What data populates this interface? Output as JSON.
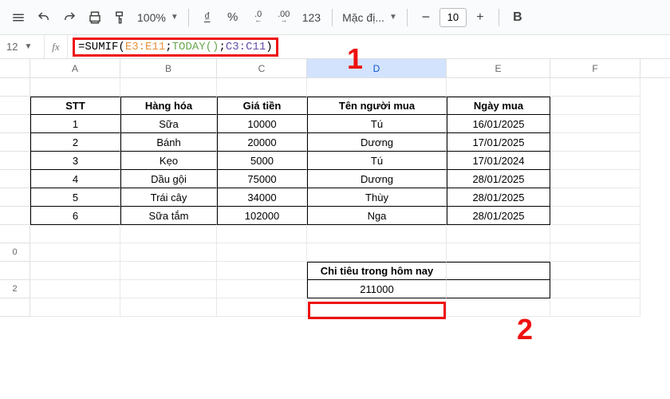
{
  "toolbar": {
    "zoom": "100%",
    "currency_icon": "₫",
    "percent": "%",
    "dec_minus_label": ".0",
    "dec_plus_label": ".00",
    "format123": "123",
    "font_label": "Mặc đị...",
    "minus": "−",
    "font_size": "10",
    "plus": "+",
    "bold": "B"
  },
  "formula_bar": {
    "cell_ref": "12",
    "fx": "fx",
    "formula_prefix": "=SUMIF(",
    "arg1": "E3:E11",
    "sep1": ";",
    "arg2": "TODAY()",
    "sep2": ";",
    "arg3": "C3:C11",
    "formula_suffix": ")"
  },
  "columns": {
    "A": "A",
    "B": "B",
    "C": "C",
    "D": "D",
    "E": "E",
    "F": "F"
  },
  "rowlabels": [
    "",
    "",
    "",
    "",
    "",
    "",
    "",
    "",
    "",
    "0",
    "",
    "2",
    ""
  ],
  "table": {
    "headers": {
      "stt": "STT",
      "hang": "Hàng hóa",
      "gia": "Giá tiền",
      "ten": "Tên người mua",
      "ngay": "Ngày mua"
    },
    "rows": [
      {
        "stt": "1",
        "hang": "Sữa",
        "gia": "10000",
        "ten": "Tú",
        "ngay": "16/01/2025"
      },
      {
        "stt": "2",
        "hang": "Bánh",
        "gia": "20000",
        "ten": "Dương",
        "ngay": "17/01/2025"
      },
      {
        "stt": "3",
        "hang": "Kẹo",
        "gia": "5000",
        "ten": "Tú",
        "ngay": "17/01/2024"
      },
      {
        "stt": "4",
        "hang": "Dầu gội",
        "gia": "75000",
        "ten": "Dương",
        "ngay": "28/01/2025"
      },
      {
        "stt": "5",
        "hang": "Trái cây",
        "gia": "34000",
        "ten": "Thùy",
        "ngay": "28/01/2025"
      },
      {
        "stt": "6",
        "hang": "Sữa tắm",
        "gia": "102000",
        "ten": "Nga",
        "ngay": "28/01/2025"
      }
    ]
  },
  "summary": {
    "label": "Chi tiêu trong hôm nay",
    "value": "211000"
  },
  "annotations": {
    "one": "1",
    "two": "2"
  }
}
